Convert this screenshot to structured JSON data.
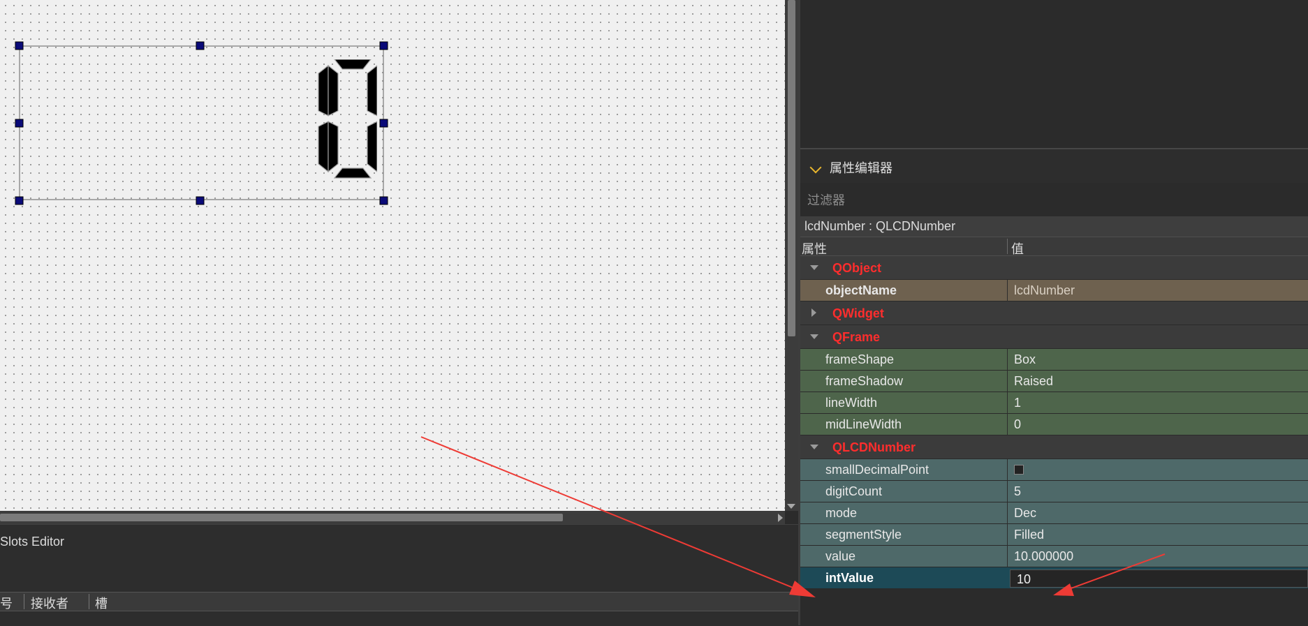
{
  "lcd_display": {
    "value": "10"
  },
  "signal_slot_editor": {
    "title": "Slots Editor",
    "columns": [
      "号",
      "接收者",
      "槽"
    ]
  },
  "property_editor": {
    "title": "属性编辑器",
    "filter_placeholder": "过滤器",
    "object_label": "lcdNumber : QLCDNumber",
    "header": {
      "property": "属性",
      "value": "值"
    },
    "groups": [
      {
        "class_name": "QObject",
        "expanded": true,
        "properties": [
          {
            "name": "objectName",
            "value": "lcdNumber"
          }
        ]
      },
      {
        "class_name": "QWidget",
        "expanded": false,
        "properties": []
      },
      {
        "class_name": "QFrame",
        "expanded": true,
        "properties": [
          {
            "name": "frameShape",
            "value": "Box"
          },
          {
            "name": "frameShadow",
            "value": "Raised"
          },
          {
            "name": "lineWidth",
            "value": "1"
          },
          {
            "name": "midLineWidth",
            "value": "0"
          }
        ]
      },
      {
        "class_name": "QLCDNumber",
        "expanded": true,
        "properties": [
          {
            "name": "smallDecimalPoint",
            "value": "",
            "checkbox": true,
            "checked": false
          },
          {
            "name": "digitCount",
            "value": "5"
          },
          {
            "name": "mode",
            "value": "Dec"
          },
          {
            "name": "segmentStyle",
            "value": "Filled"
          },
          {
            "name": "value",
            "value": "10.000000"
          },
          {
            "name": "intValue",
            "value": "10",
            "selected": true
          }
        ]
      }
    ]
  },
  "colors": {
    "class_header_text": "#ff2d2d",
    "annotation_arrow": "#ee3b35",
    "qobject_row": "#6e614f",
    "qframe_row": "#4e654b",
    "qlcdnumber_row": "#4e6969",
    "selected_row": "#1d4a57"
  },
  "icons": {
    "expanded": "triangle-down-icon",
    "collapsed": "triangle-right-icon",
    "dock": "chevron-down-icon"
  }
}
